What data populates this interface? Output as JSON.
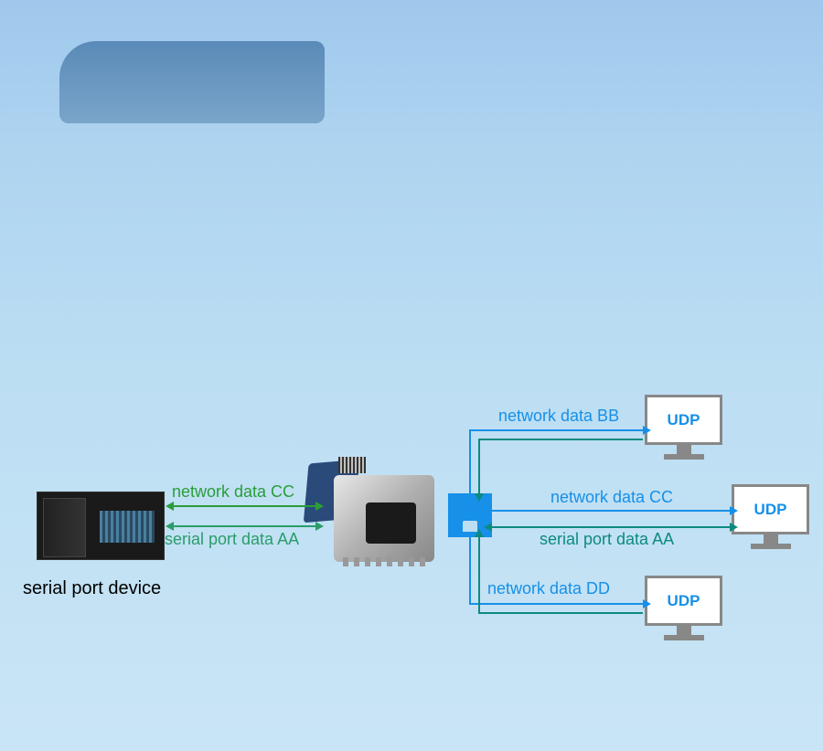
{
  "plc_label": "serial port device",
  "udp_label": "UDP",
  "left": {
    "network_cc": "network data CC",
    "serial_aa": "serial port data AA"
  },
  "right": {
    "network_bb": "network data BB",
    "network_cc": "network data CC",
    "serial_aa": "serial port data AA",
    "network_dd": "network data DD"
  },
  "colors": {
    "blue": "#1690e8",
    "teal": "#0d8a7f",
    "green": "#2a9d3a"
  }
}
